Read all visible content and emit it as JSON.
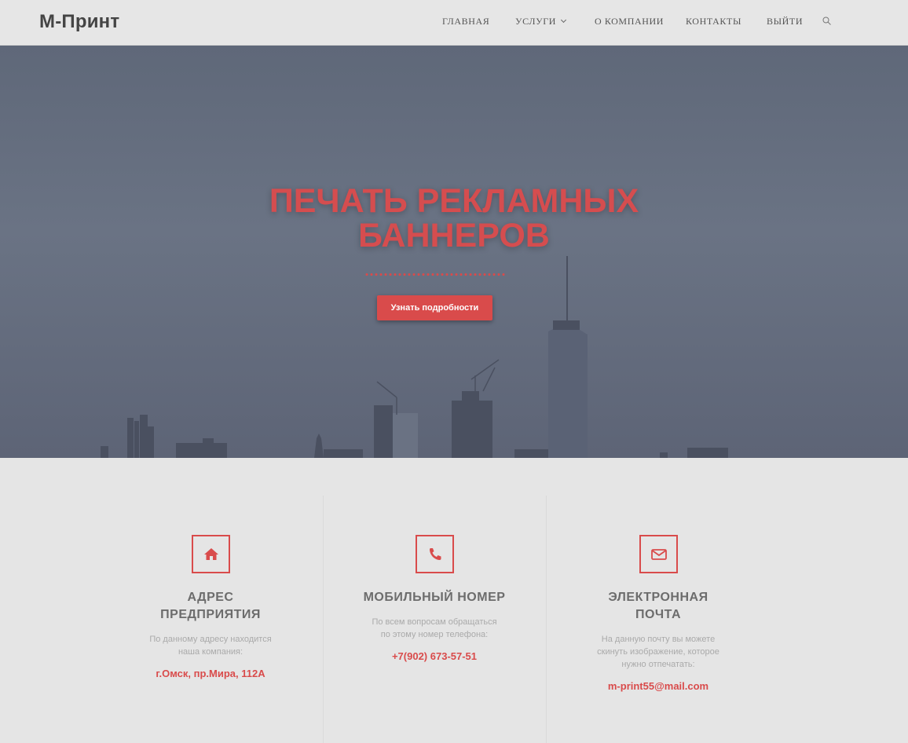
{
  "header": {
    "logo": "М-Принт",
    "nav": [
      "ГЛАВНАЯ",
      "УСЛУГИ",
      "О КОМПАНИИ",
      "КОНТАКТЫ",
      "ВЫЙТИ"
    ],
    "search_icon": "search-icon"
  },
  "hero": {
    "title_line1": "ПЕЧАТЬ РЕКЛАМНЫХ",
    "title_line2": "БАННЕРОВ",
    "button_label": "Узнать подробности"
  },
  "features": [
    {
      "icon": "home-icon",
      "title_line1": "АДРЕС",
      "title_line2": "ПРЕДПРИЯТИЯ",
      "text_line1": "По данному адресу находится",
      "text_line2": "наша компания:",
      "text_line3": "",
      "value": "г.Омск, пр.Мира, 112А"
    },
    {
      "icon": "phone-icon",
      "title_line1": "МОБИЛЬНЫЙ НОМЕР",
      "title_line2": "",
      "text_line1": "По всем вопросам обращаться",
      "text_line2": "по этому номер телефона:",
      "text_line3": "",
      "value": "+7(902) 673-57-51"
    },
    {
      "icon": "envelope-icon",
      "title_line1": "ЭЛЕКТРОННАЯ",
      "title_line2": "ПОЧТА",
      "text_line1": "На данную почту вы можете",
      "text_line2": "скинуть изображение, которое",
      "text_line3": "нужно отпечатать:",
      "value": "m-print55@mail.com"
    }
  ],
  "colors": {
    "accent": "#d94b4b",
    "header_bg": "#e6e6e6",
    "hero_overlay": "#6a7384",
    "page_bg": "#e4e4e4"
  }
}
